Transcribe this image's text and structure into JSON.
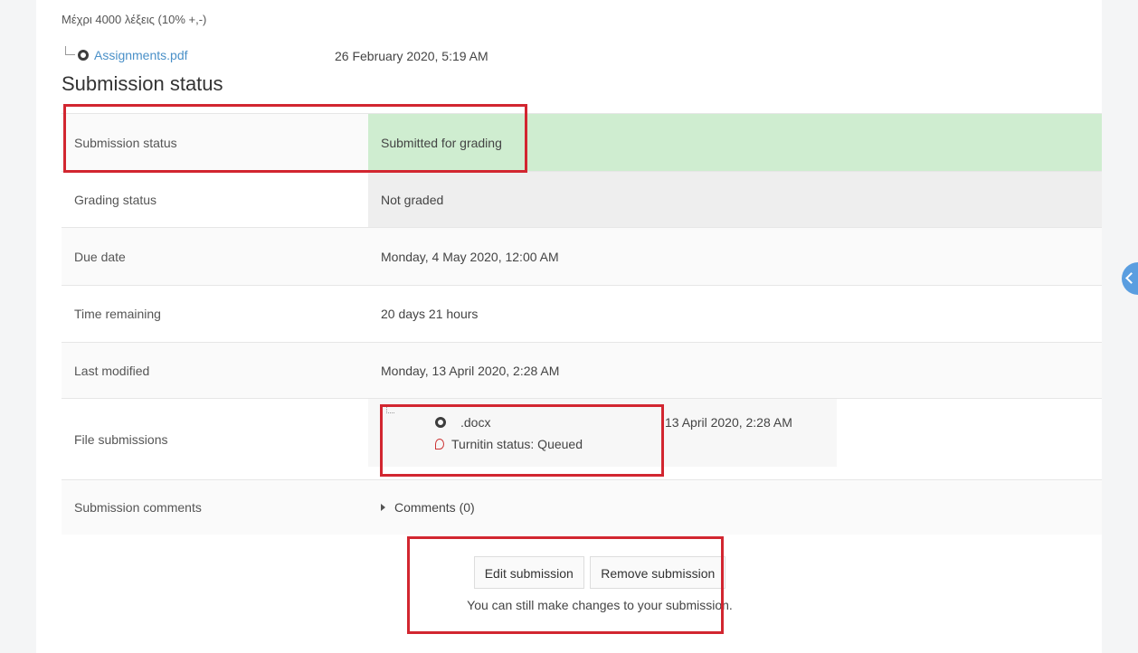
{
  "intro": {
    "text": "Μέχρι 4000 λέξεις (10% +,-)"
  },
  "attachment": {
    "name": "Assignments.pdf",
    "date": "26 February 2020, 5:19 AM"
  },
  "section": {
    "title": "Submission status"
  },
  "rows": [
    {
      "label": "Submission status",
      "value": "Submitted for grading"
    },
    {
      "label": "Grading status",
      "value": "Not graded"
    },
    {
      "label": "Due date",
      "value": "Monday, 4 May 2020, 12:00 AM"
    },
    {
      "label": "Time remaining",
      "value": "20 days 21 hours"
    },
    {
      "label": "Last modified",
      "value": "Monday, 13 April 2020, 2:28 AM"
    },
    {
      "label": "File submissions",
      "value": ""
    },
    {
      "label": "Submission comments",
      "value": ""
    }
  ],
  "file_submission": {
    "file_ext": ".docx",
    "turnitin": "Turnitin status: Queued",
    "date": "13 April 2020, 2:28 AM"
  },
  "comments": {
    "label": "Comments (0)"
  },
  "actions": {
    "edit_label": "Edit submission",
    "remove_label": "Remove submission",
    "hint": "You can still make changes to your submission."
  },
  "colors": {
    "submitted_bg": "#cfedd0",
    "highlight": "#d22630",
    "link": "#4a90c8"
  },
  "icons": {
    "file": "file-icon",
    "turnitin": "turnitin-icon",
    "drawer": "chevron-left-icon"
  }
}
